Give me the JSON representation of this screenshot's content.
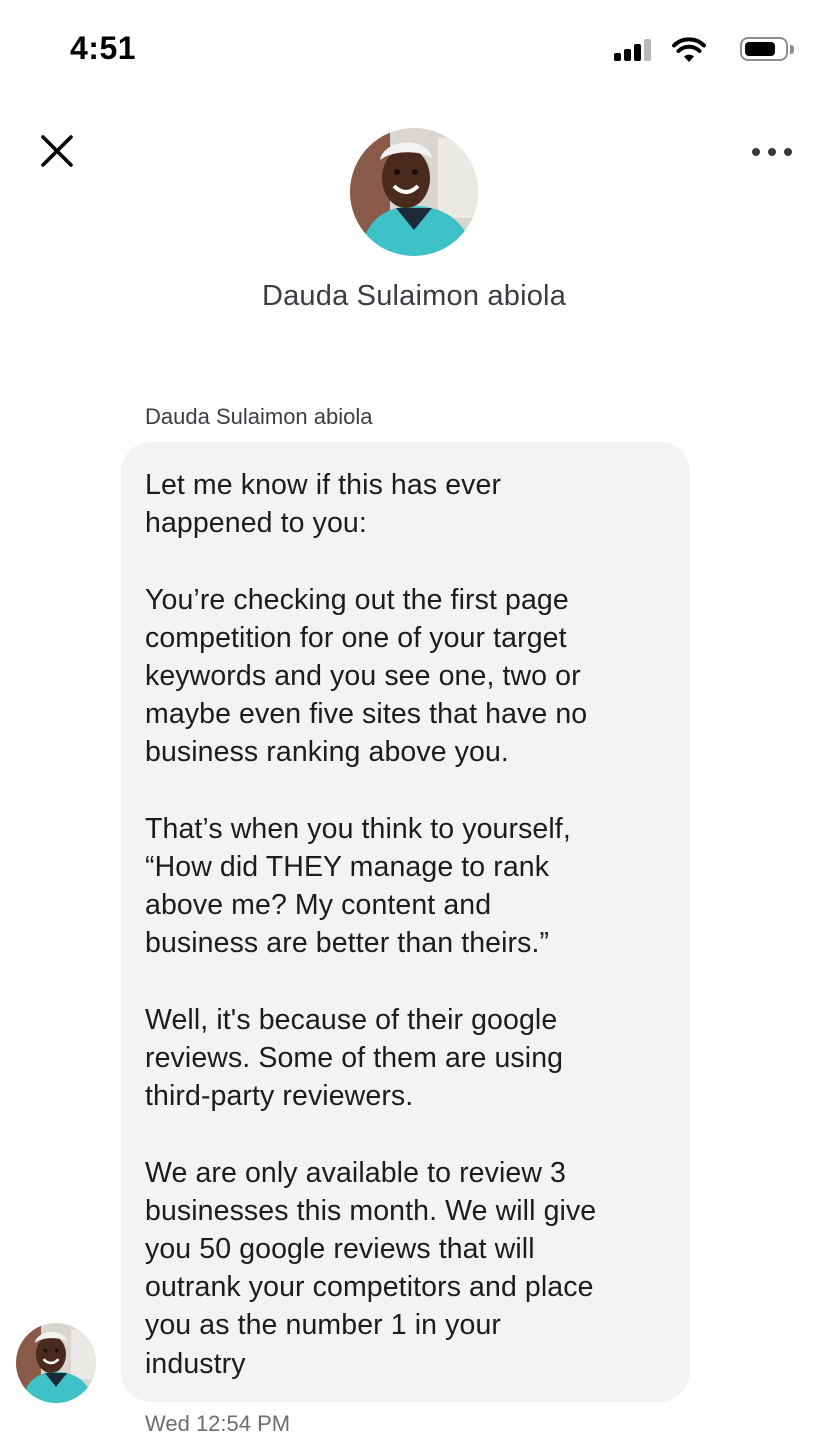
{
  "status_bar": {
    "time": "4:51",
    "icons": [
      "signal-icon",
      "wifi-icon",
      "battery-icon"
    ],
    "battery_level": 0.8
  },
  "header": {
    "close_icon": "close-icon",
    "more_icon": "more-horizontal-icon",
    "contact_name": "Dauda Sulaimon abiola"
  },
  "thread": {
    "sender_name": "Dauda Sulaimon abiola",
    "message": "Let me know if this has ever\nhappened to you:\n\nYou’re checking out the first page\ncompetition for one of your target\nkeywords and you see one, two or\nmaybe even five sites that have no\nbusiness ranking above you.\n\nThat’s when you think to yourself,\n“How did THEY manage to rank\nabove me? My content and\nbusiness are better than theirs.”\n\nWell, it's because of their google\nreviews. Some of them are using\nthird-party reviewers.\n\nWe are only available to review 3\nbusinesses this month. We will give\nyou 50 google reviews that will\noutrank your competitors and place\nyou as the number 1 in your\nindustry",
    "timestamp": "Wed 12:54 PM"
  },
  "colors": {
    "bubble": "#f3f3f3",
    "avatar_shirt": "#3ec1c7",
    "avatar_skin": "#4a2a1c",
    "avatar_cap": "#f2f2f2"
  }
}
